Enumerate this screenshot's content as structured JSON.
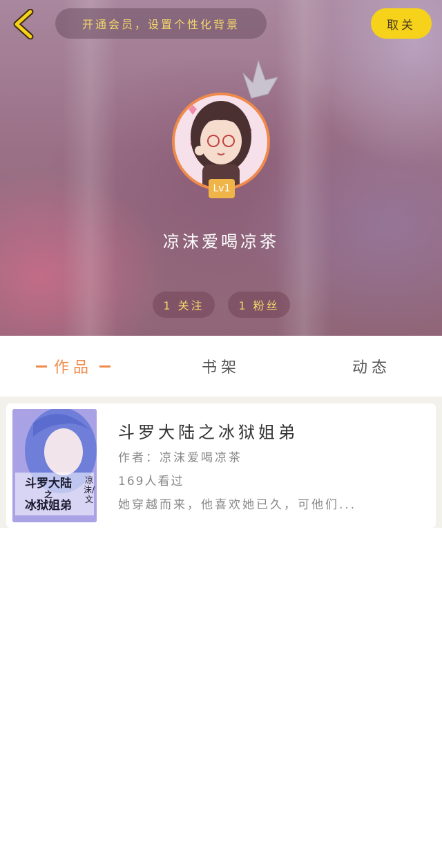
{
  "header": {
    "vip_banner": "开通会员，设置个性化背景",
    "follow_label": "取关",
    "level": "Lv1",
    "username": "凉沫爱喝凉茶",
    "following_label": "1 关注",
    "fans_label": "1 粉丝"
  },
  "tabs": {
    "works": "作品",
    "shelf": "书架",
    "dynamic": "动态"
  },
  "book": {
    "title": "斗罗大陆之冰狱姐弟",
    "author_line": "作者：凉沫爱喝凉茶",
    "views": "169人看过",
    "summary": "她穿越而来，他喜欢她已久，可他们...",
    "cover_title_line1": "斗罗大陆",
    "cover_title_line2": "之",
    "cover_title_line3": "冰狱姐弟",
    "cover_author": "凉沫/文"
  },
  "colors": {
    "accent": "#f08a4b",
    "gold_text": "#f4d86a",
    "follow_button": "#f6d21a"
  }
}
